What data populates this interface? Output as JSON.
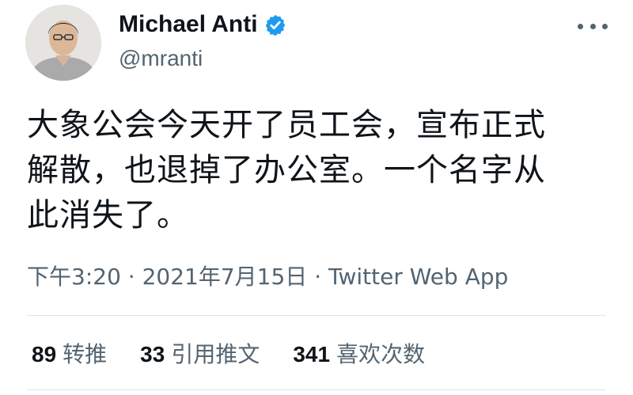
{
  "user": {
    "display_name": "Michael Anti",
    "handle": "@mranti",
    "verified": true,
    "avatar_icon": "user-avatar"
  },
  "tweet": {
    "lines": [
      "大象公会今天开了员工会，宣布正式",
      "解散，也退掉了办公室。一个名字从",
      "此消失了。"
    ]
  },
  "meta": {
    "time": "下午3:20",
    "separator": " · ",
    "date": "2021年7月15日",
    "source": "Twitter Web App"
  },
  "stats": [
    {
      "count": "89",
      "label": "转推"
    },
    {
      "count": "33",
      "label": "引用推文"
    },
    {
      "count": "341",
      "label": "喜欢次数"
    }
  ],
  "colors": {
    "verified_blue": "#1d9bf0",
    "secondary_text": "#536471",
    "primary_text": "#0f1419"
  }
}
